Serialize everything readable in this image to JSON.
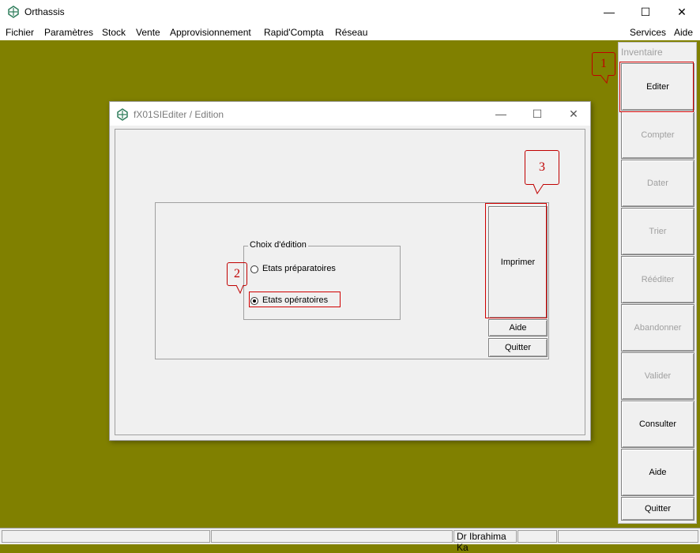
{
  "app": {
    "title": "Orthassis",
    "window_buttons": {
      "minimize": "—",
      "maximize": "☐",
      "close": "✕"
    }
  },
  "menu": {
    "left": [
      "Fichier",
      "Paramètres",
      "Stock",
      "Vente",
      "Approvisionnement",
      "Rapid'Compta",
      "Réseau"
    ],
    "right": [
      "Services",
      "Aide"
    ]
  },
  "side_panel": {
    "title": "Inventaire",
    "buttons": [
      {
        "label": "Editer",
        "enabled": true
      },
      {
        "label": "Compter",
        "enabled": false
      },
      {
        "label": "Dater",
        "enabled": false
      },
      {
        "label": "Trier",
        "enabled": false
      },
      {
        "label": "Rééditer",
        "enabled": false
      },
      {
        "label": "Abandonner",
        "enabled": false
      },
      {
        "label": "Valider",
        "enabled": false
      },
      {
        "label": "Consulter",
        "enabled": true
      },
      {
        "label": "Aide",
        "enabled": true
      },
      {
        "label": "Quitter",
        "enabled": true
      }
    ]
  },
  "dialog": {
    "title": "fX01SIEditer / Edition",
    "group_label": "Choix d'édition",
    "options": [
      {
        "label": "Etats préparatoires",
        "checked": false
      },
      {
        "label": "Etats opératoires",
        "checked": true
      }
    ],
    "print_button": "Imprimer",
    "help_button": "Aide",
    "quit_button": "Quitter"
  },
  "callouts": [
    "1",
    "2",
    "3"
  ],
  "status_bar": {
    "user": "Dr Ibrahima Ka"
  },
  "colors": {
    "desktop": "#808000",
    "annotation": "#c00000"
  }
}
